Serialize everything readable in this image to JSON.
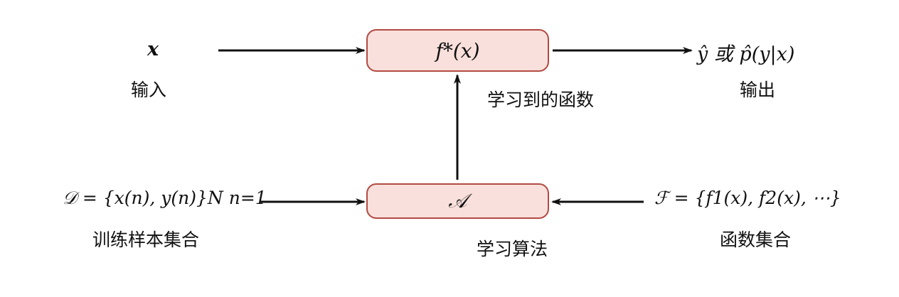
{
  "nodes": {
    "input_var": "x",
    "input_label": "输入",
    "function_box": "f*(x)",
    "learned_function_label": "学习到的函数",
    "output_var": "ŷ 或 p̂(y|x)",
    "output_label": "输出",
    "dataset_math": "𝒟 = {x(n), y(n)}N n=1",
    "dataset_label": "训练样本集合",
    "algorithm_box": "𝒜",
    "algorithm_label": "学习算法",
    "function_set_math": "ℱ = {f1(x), f2(x), ⋯}",
    "function_set_label": "函数集合"
  }
}
